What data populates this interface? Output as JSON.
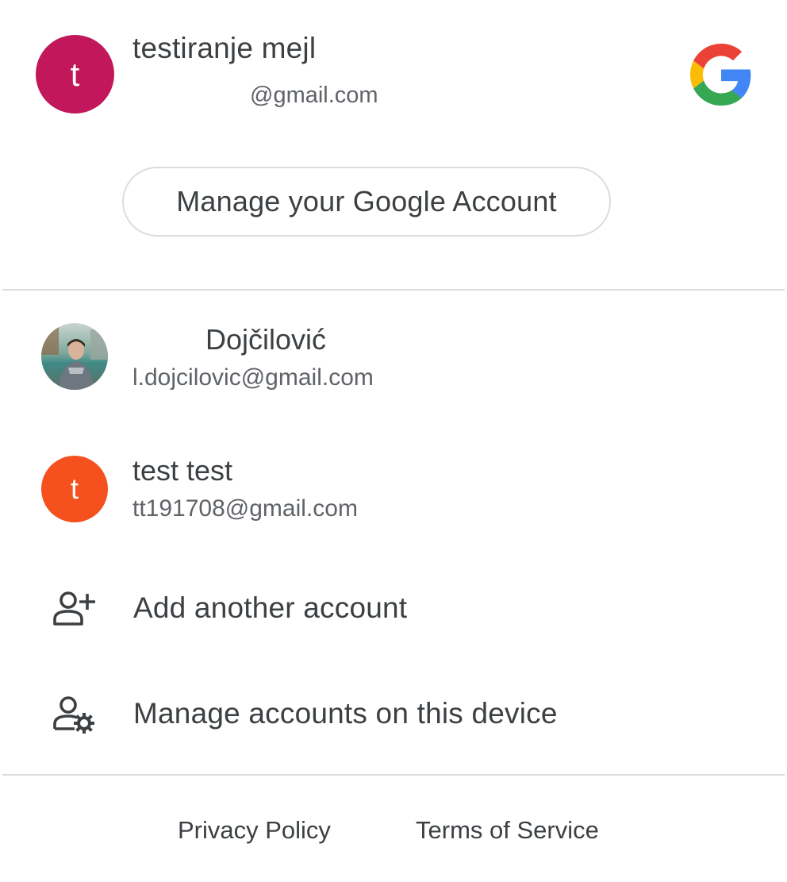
{
  "primary_account": {
    "avatar_letter": "t",
    "avatar_color": "#c2185b",
    "name": "testiranje mejl",
    "email_suffix": "@gmail.com",
    "manage_button_label": "Manage your Google Account"
  },
  "accounts": [
    {
      "name_suffix": "Dojčilović",
      "email": "l.dojcilovic@gmail.com",
      "avatar": "profile-photo"
    },
    {
      "avatar_letter": "t",
      "avatar_color": "#f4511e",
      "name": "test test",
      "email": "tt191708@gmail.com"
    }
  ],
  "actions": {
    "add_account_label": "Add another account",
    "add_account_icon": "person-add-icon",
    "manage_accounts_label": "Manage accounts on this device",
    "manage_accounts_icon": "manage-accounts-icon"
  },
  "footer": {
    "privacy_label": "Privacy Policy",
    "terms_label": "Terms of Service"
  },
  "colors": {
    "text_primary": "#3c4043",
    "text_secondary": "#5f6368",
    "divider": "#dadce0"
  }
}
